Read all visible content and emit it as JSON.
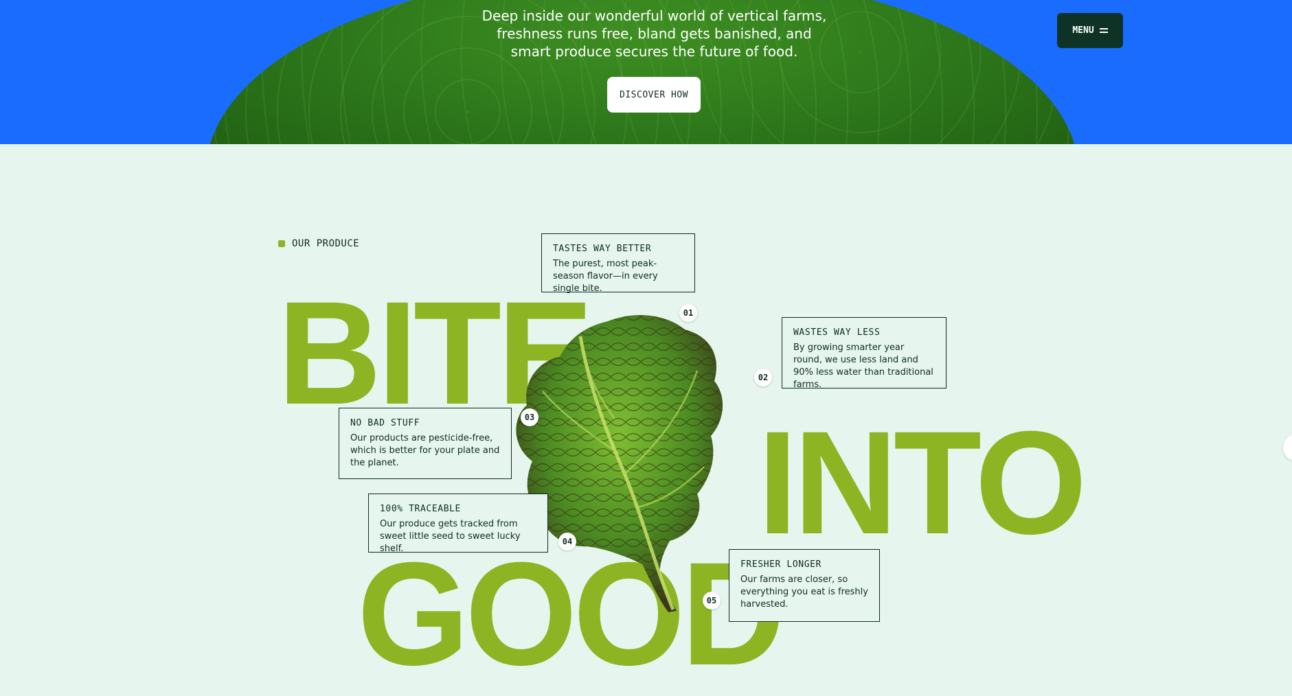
{
  "hero": {
    "tagline": "Deep inside our wonderful world of vertical farms, freshness runs free, bland gets banished, and smart produce secures the future of food.",
    "cta_label": "DISCOVER HOW",
    "bg_color": "#1a6cff"
  },
  "nav": {
    "menu_label": "MENU",
    "menu_icon": "hamburger-icon"
  },
  "produce": {
    "section_label": "OUR PRODUCE",
    "headline": [
      "BITE",
      "INTO",
      "GOOD"
    ],
    "accent_color": "#8db523",
    "features": [
      {
        "num": "01",
        "title": "TASTES WAY BETTER",
        "text": "The purest, most peak-season flavor—in every single bite."
      },
      {
        "num": "02",
        "title": "WASTES WAY LESS",
        "text": "By growing smarter year round, we use less land and 90% less water than traditional farms."
      },
      {
        "num": "03",
        "title": "NO BAD STUFF",
        "text": "Our products are pesticide-free, which is better for your plate and the planet."
      },
      {
        "num": "04",
        "title": "100% TRACEABLE",
        "text": "Our produce gets tracked from sweet little seed to sweet lucky shelf."
      },
      {
        "num": "05",
        "title": "FRESHER LONGER",
        "text": "Our farms are closer, so everything you eat is freshly harvested."
      }
    ]
  }
}
